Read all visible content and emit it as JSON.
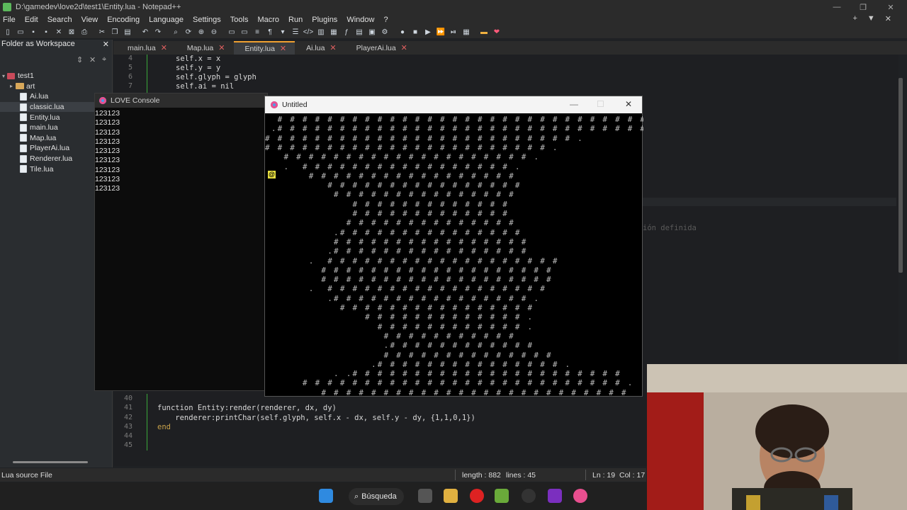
{
  "window": {
    "title": "D:\\gamedev\\love2d\\test1\\Entity.lua - Notepad++"
  },
  "menu": [
    "File",
    "Edit",
    "Search",
    "View",
    "Encoding",
    "Language",
    "Settings",
    "Tools",
    "Macro",
    "Run",
    "Plugins",
    "Window",
    "?"
  ],
  "workspace": {
    "header": "Folder as Workspace",
    "root": "test1",
    "items": [
      {
        "label": "art",
        "type": "folder"
      },
      {
        "label": "Ai.lua",
        "type": "file"
      },
      {
        "label": "classic.lua",
        "type": "file"
      },
      {
        "label": "Entity.lua",
        "type": "file"
      },
      {
        "label": "main.lua",
        "type": "file"
      },
      {
        "label": "Map.lua",
        "type": "file"
      },
      {
        "label": "PlayerAi.lua",
        "type": "file"
      },
      {
        "label": "Renderer.lua",
        "type": "file"
      },
      {
        "label": "Tile.lua",
        "type": "file"
      }
    ]
  },
  "tabs": [
    {
      "label": "main.lua",
      "active": false
    },
    {
      "label": "Map.lua",
      "active": false
    },
    {
      "label": "Entity.lua",
      "active": true
    },
    {
      "label": "Ai.lua",
      "active": false
    },
    {
      "label": "PlayerAi.lua",
      "active": false
    }
  ],
  "editor": {
    "top_lines": [
      {
        "num": "4",
        "text": "self.x = x"
      },
      {
        "num": "5",
        "text": "self.y = y"
      },
      {
        "num": "6",
        "text": "self.glyph = glyph"
      },
      {
        "num": "7",
        "text": "self.ai = nil"
      }
    ],
    "bottom_lines": [
      {
        "num": "40",
        "text": ""
      },
      {
        "num": "41",
        "text": "function Entity:render(renderer, dx, dy)"
      },
      {
        "num": "42",
        "text": "    renderer:printChar(self.glyph, self.x - dx, self.y - dy, {1,1,0,1})"
      },
      {
        "num": "43",
        "text": "end"
      },
      {
        "num": "44",
        "text": ""
      },
      {
        "num": "45",
        "text": ""
      }
    ],
    "faint_text": "ión definida"
  },
  "console": {
    "title": "LOVE Console",
    "lines": [
      "123123",
      "123123",
      "123123",
      "123123",
      "123123",
      "123123",
      "123123",
      "123123",
      "123123"
    ]
  },
  "game": {
    "title": "Untitled",
    "player_glyph": "@",
    "map_rows": [
      "  # # # # # # # # # # # # # # # # # # # # # # # # # # # # # # #",
      " .# # # # # # # # # # # # # # # # # # # # # # # # # # # # # # #",
      "# # # # # # # # # # # # # # # # # # # # # # # # # .",
      "# # # # # # # # # # # # # # # # # # # # # # # .",
      "   # # # # # # # # # # # # # # # # # # # # .",
      "   .  # # # # # # # # # # # # # # # # # .",
      "       # # # # # # # # # # # # # # # # #",
      "          # # # # # # # # # # # # # # # #",
      "           # # # # # # # # # # # # # # #",
      "              # # # # # # # # # # # # #",
      "              # # # # # # # # # # # # #",
      "             # # # # # # # # # # # # # #",
      "           .# # # # # # # # # # # # # # #",
      "           # # # # # # # # # # # # # # # #",
      "          .# # # # # # # # # # # # # # # #",
      "       .  # # # # # # # # # # # # # # # # # # #",
      "         # # # # # # # # # # # # # # # # # # #",
      "         # # # # # # # # # # # # # # # # # # #",
      "       .  # # # # # # # # # # # # # # # # # #",
      "          .# # # # # # # # # # # # # # # # .",
      "            # # # # # # # # # # # # # # # #",
      "                # # # # # # # # # # # # # .",
      "                  # # # # # # # # # # # # .",
      "                   # # # # # # # # # # #",
      "                   .# # # # # # # # # # # #",
      "                   # # # # # # # # # # # # # #",
      "                 .# # # # # # # # # # # # # # # .",
      "           . .# # # # # # # # # # # # # # # # # # # # # #",
      "      # # # # # # # # # # # # # # # # # # # # # # # # # # .",
      "         # # # # # # # # # # # # # # # # # # # # # # # # #"
    ]
  },
  "status": {
    "file_type": "Lua source File",
    "length": "length : 882",
    "lines": "lines : 45",
    "ln": "Ln : 19",
    "col": "Col : 17"
  },
  "taskbar": {
    "search_label": "Búsqueda"
  },
  "colors": {
    "accent_tab": "#f0a030",
    "player": "#e8e040",
    "fold": "#3aa83a"
  },
  "icons": [
    "windows-start-icon",
    "search-icon",
    "task-view-icon",
    "file-explorer-icon",
    "opera-icon",
    "notepadpp-icon",
    "steam-icon",
    "onenote-icon",
    "love2d-icon"
  ]
}
